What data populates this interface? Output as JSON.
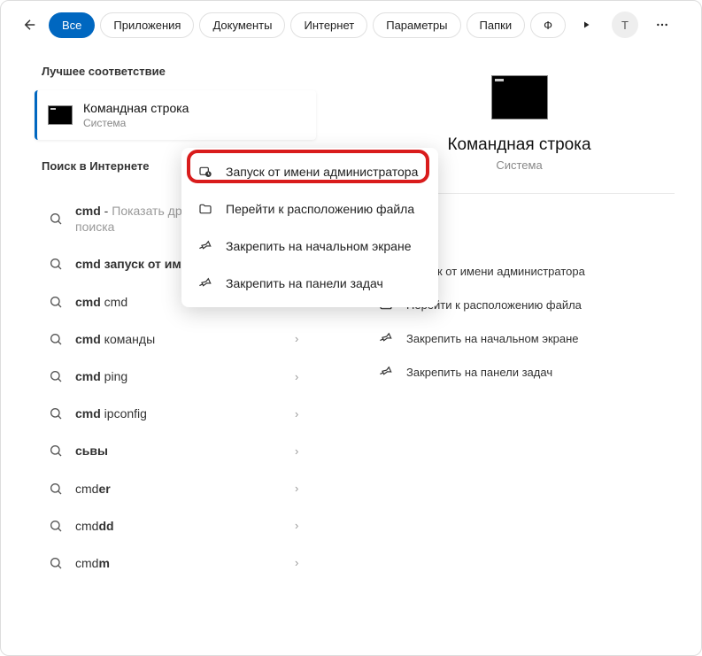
{
  "header": {
    "tabs": [
      {
        "label": "Все",
        "active": true
      },
      {
        "label": "Приложения",
        "active": false
      },
      {
        "label": "Документы",
        "active": false
      },
      {
        "label": "Интернет",
        "active": false
      },
      {
        "label": "Параметры",
        "active": false
      },
      {
        "label": "Папки",
        "active": false
      },
      {
        "label": "Ф",
        "active": false
      }
    ],
    "avatar_letter": "T"
  },
  "left": {
    "best_match_title": "Лучшее соответствие",
    "best_match": {
      "title": "Командная строка",
      "subtitle": "Система"
    },
    "web_title": "Поиск в Интернете",
    "items": [
      {
        "html": "<b>cmd</b> - <span class='muted'>Показать другие результаты поиска</span>",
        "chevron": false
      },
      {
        "html": "<b>cmd запуск от имени администратора</b>",
        "chevron": false
      },
      {
        "html": "<b>cmd</b> cmd",
        "chevron": true
      },
      {
        "html": "<b>cmd</b> команды",
        "chevron": true
      },
      {
        "html": "<b>cmd</b> ping",
        "chevron": true
      },
      {
        "html": "<b>cmd</b> ipconfig",
        "chevron": true
      },
      {
        "html": "<b>сьвы</b>",
        "chevron": true
      },
      {
        "html": "cmd<b>er</b>",
        "chevron": true
      },
      {
        "html": "cmd<b>dd</b>",
        "chevron": true
      },
      {
        "html": "cmd<b>m</b>",
        "chevron": true
      }
    ]
  },
  "right": {
    "title": "Командная строка",
    "subtitle": "Система",
    "actions": [
      {
        "icon": "admin",
        "label": "Запуск от имени администратора"
      },
      {
        "icon": "folder",
        "label": "Перейти к расположению файла"
      },
      {
        "icon": "pin",
        "label": "Закрепить на начальном экране"
      },
      {
        "icon": "pin",
        "label": "Закрепить на панели задач"
      }
    ]
  },
  "context_menu": [
    {
      "icon": "admin",
      "label": "Запуск от имени администратора"
    },
    {
      "icon": "folder",
      "label": "Перейти к расположению файла"
    },
    {
      "icon": "pin",
      "label": "Закрепить на начальном экране"
    },
    {
      "icon": "pin",
      "label": "Закрепить на панели задач"
    }
  ]
}
